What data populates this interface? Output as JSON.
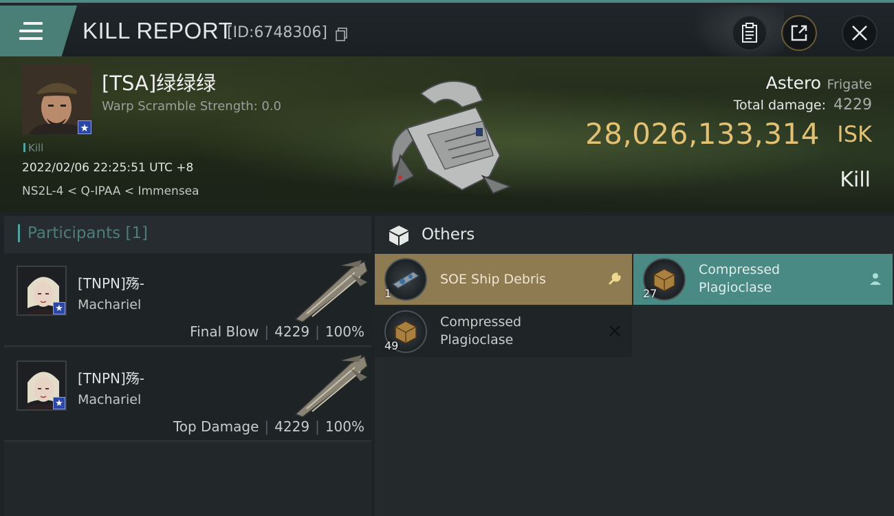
{
  "header": {
    "title": "KILL REPORT",
    "report_id": "[ID:6748306]"
  },
  "victim": {
    "name": "[TSA]绿绿绿",
    "warp_scramble": "Warp Scramble Strength: 0.0",
    "tag": "Kill",
    "datetime": "2022/02/06 22:25:51 UTC +8",
    "location": "NS2L-4 < Q-IPAA < Immensea",
    "ship_name": "Astero",
    "ship_class": "Frigate",
    "total_damage_label": "Total damage:",
    "total_damage": "4229",
    "isk_value": "28,026,133,314",
    "isk_unit": "ISK",
    "result": "Kill"
  },
  "participants": {
    "title": "Participants [1]",
    "rows": [
      {
        "name": "[TNPN]殇-",
        "ship": "Machariel",
        "role": "Final Blow",
        "damage": "4229",
        "percent": "100%"
      },
      {
        "name": "[TNPN]殇-",
        "ship": "Machariel",
        "role": "Top Damage",
        "damage": "4229",
        "percent": "100%"
      }
    ]
  },
  "others": {
    "title": "Others",
    "items": [
      {
        "name": "SOE Ship Debris",
        "qty": "1",
        "status": "dropped",
        "flag_icon": "wrench-icon"
      },
      {
        "name": "Compressed Plagioclase",
        "qty": "27",
        "status": "looted",
        "flag_icon": "person-icon"
      },
      {
        "name": "Compressed Plagioclase",
        "qty": "49",
        "status": "destroyed",
        "flag_icon": "cross-icon"
      }
    ]
  },
  "colors": {
    "accent_teal": "#4a7f78",
    "isk_gold": "#e2c173",
    "dropped_bg": "#8e7b52",
    "looted_bg": "#4a8a84"
  }
}
